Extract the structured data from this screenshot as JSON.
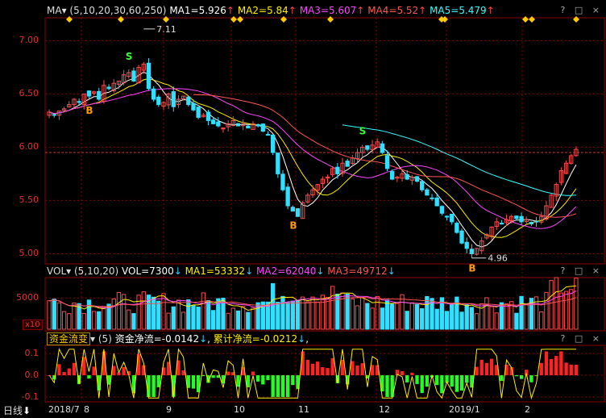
{
  "main_header": {
    "title": "MA",
    "params": "(5,10,20,30,60,250)",
    "ma1": "MA1=5.926",
    "ma2": "MA2=5.84",
    "ma3": "MA3=5.607",
    "ma4": "MA4=5.52",
    "ma5": "MA5=5.479",
    "corner_icons": "? □ ×"
  },
  "vol_header": {
    "title": "VOL",
    "params": "(5,10,20)",
    "vol": "VOL=7300",
    "ma1": "MA1=53332",
    "ma2": "MA2=62040",
    "ma3": "MA3=49712",
    "corner_icons": "? □ ×",
    "unit": "x10"
  },
  "flow_header": {
    "title": "资金流变",
    "param": "(5)",
    "net_flow": "资金净流=-0.0142",
    "cum_flow": "累计净流=-0.0212",
    "corner_icons": "? □ ×"
  },
  "footer": {
    "period": "日线",
    "period_arrow": "⬇"
  },
  "colors": {
    "up": "#ff4b4b",
    "down": "#33dfff",
    "ma1": "#ffffff",
    "ma2": "#ffee00",
    "ma3": "#ff44ff",
    "ma4": "#ff5555",
    "ma5": "#33ffff",
    "signal_buy": "#ff9900",
    "signal_sell": "#33ff33",
    "grid": "#8b0000"
  },
  "chart_data": [
    {
      "type": "candlestick",
      "title": "MA",
      "ylim": [
        4.92,
        7.2
      ],
      "yticks": [
        "7.00",
        "6.50",
        "6.00",
        "5.50",
        "5.00"
      ],
      "ytick_values": [
        7.0,
        6.5,
        6.0,
        5.5,
        5.0
      ],
      "xticks": [
        "2018/7",
        "8",
        "9",
        "10",
        "11",
        "12",
        "2019/1",
        "2"
      ],
      "annotations": [
        {
          "text": "7.11",
          "kind": "high"
        },
        {
          "text": "4.96",
          "kind": "low"
        }
      ],
      "signals": [
        {
          "label": "B",
          "kind": "buy"
        },
        {
          "label": "S",
          "kind": "sell"
        },
        {
          "label": "B",
          "kind": "buy"
        },
        {
          "label": "S",
          "kind": "sell"
        },
        {
          "label": "B",
          "kind": "buy"
        }
      ],
      "reference_line": 5.95,
      "close_approx": [
        6.33,
        6.3,
        6.34,
        6.36,
        6.4,
        6.45,
        6.42,
        6.5,
        6.48,
        6.52,
        6.45,
        6.58,
        6.55,
        6.6,
        6.62,
        6.68,
        6.7,
        6.62,
        6.75,
        6.78,
        6.55,
        6.45,
        6.4,
        6.42,
        6.5,
        6.38,
        6.45,
        6.48,
        6.4,
        6.35,
        6.28,
        6.3,
        6.25,
        6.22,
        6.2,
        6.18,
        6.22,
        6.25,
        6.2,
        6.22,
        6.18,
        6.22,
        6.2,
        6.15,
        6.12,
        5.95,
        5.75,
        5.6,
        5.45,
        5.4,
        5.35,
        5.48,
        5.55,
        5.6,
        5.65,
        5.7,
        5.72,
        5.8,
        5.75,
        5.85,
        5.82,
        5.9,
        5.95,
        6.0,
        5.98,
        6.02,
        6.05,
        5.95,
        5.8,
        5.7,
        5.72,
        5.75,
        5.7,
        5.72,
        5.68,
        5.6,
        5.55,
        5.52,
        5.45,
        5.38,
        5.35,
        5.3,
        5.2,
        5.1,
        5.05,
        5.0,
        5.05,
        5.12,
        5.18,
        5.25,
        5.3,
        5.28,
        5.32,
        5.35,
        5.33,
        5.3,
        5.32,
        5.28,
        5.3,
        5.35,
        5.45,
        5.55,
        5.65,
        5.78,
        5.85,
        5.92,
        5.98
      ]
    },
    {
      "type": "bar",
      "title": "VOL",
      "yticks": [
        "5000"
      ],
      "ytick_values": [
        5000
      ],
      "ylim": [
        0,
        8000
      ]
    },
    {
      "type": "bar",
      "title": "资金流变",
      "yticks": [
        "0.1",
        "0.0",
        "-0.1"
      ],
      "ytick_values": [
        0.1,
        0.0,
        -0.1
      ],
      "ylim": [
        -0.115,
        0.13
      ]
    }
  ]
}
